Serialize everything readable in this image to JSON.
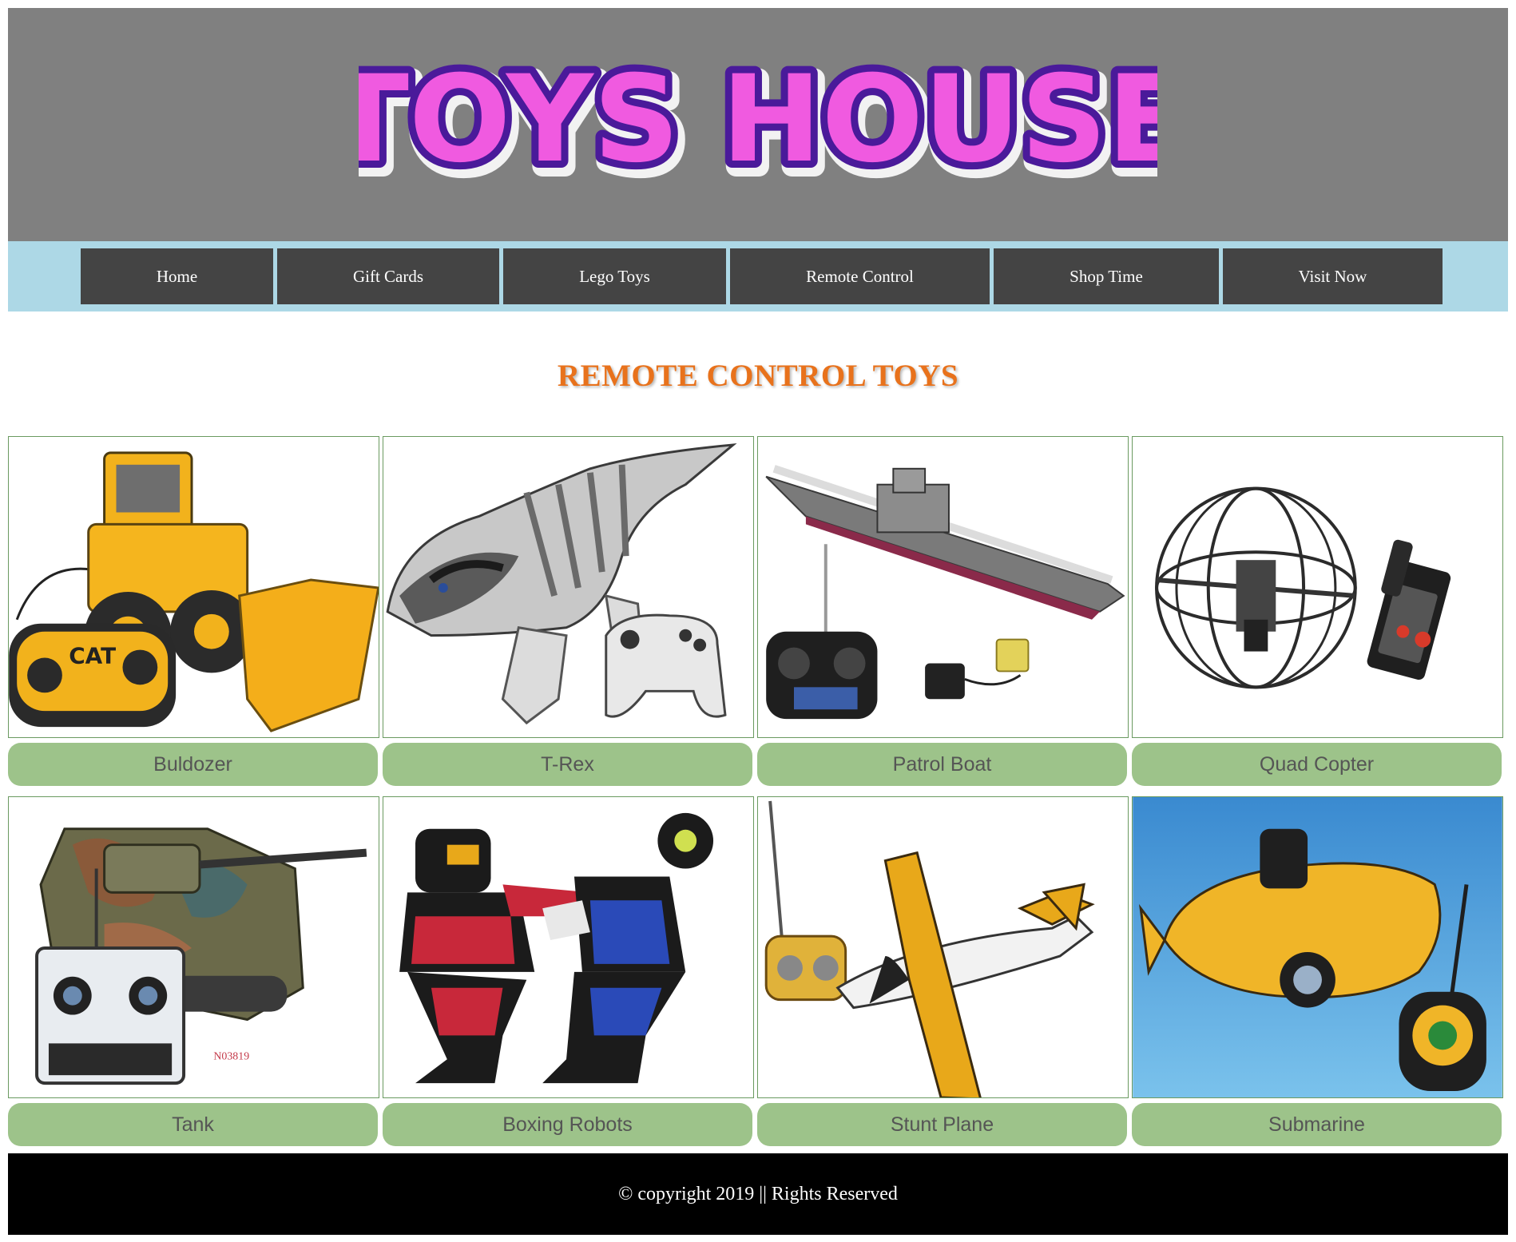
{
  "header": {
    "logo_text": "TOYS HOUSE",
    "logo_fill": "#f05ae0",
    "logo_outline": "#4a1a9a"
  },
  "nav": {
    "items": [
      {
        "label": "Home"
      },
      {
        "label": "Gift Cards"
      },
      {
        "label": "Lego Toys"
      },
      {
        "label": "Remote Control"
      },
      {
        "label": "Shop Time"
      },
      {
        "label": "Visit Now"
      }
    ]
  },
  "page": {
    "title": "REMOTE CONTROL TOYS",
    "title_color": "#e8721c"
  },
  "products": [
    {
      "name": "Buldozer",
      "icon": "bulldozer-image"
    },
    {
      "name": "T-Rex",
      "icon": "trex-robot-image"
    },
    {
      "name": "Patrol Boat",
      "icon": "patrol-boat-image"
    },
    {
      "name": "Quad Copter",
      "icon": "quad-copter-image"
    },
    {
      "name": "Tank",
      "icon": "tank-image"
    },
    {
      "name": "Boxing Robots",
      "icon": "boxing-robots-image"
    },
    {
      "name": "Stunt Plane",
      "icon": "stunt-plane-image"
    },
    {
      "name": "Submarine",
      "icon": "submarine-image"
    }
  ],
  "images": {
    "tank_code": "N03819",
    "bulldozer_brand": "CAT"
  },
  "footer": {
    "text": "© copyright 2019 || Rights Reserved"
  },
  "colors": {
    "header_bg": "#808080",
    "nav_bg": "#add8e6",
    "nav_item_bg": "#444444",
    "label_bg": "#9dc38a",
    "footer_bg": "#000000"
  }
}
